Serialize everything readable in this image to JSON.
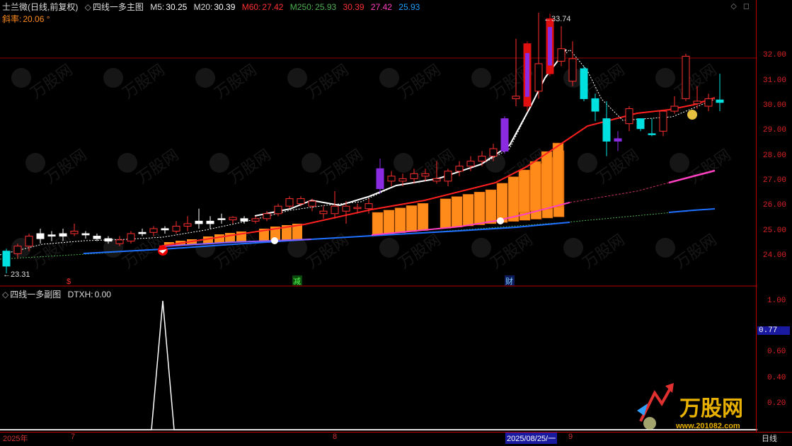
{
  "header": {
    "stock_name": "士兰微(日线,前复权)",
    "main_title": "四线一多主图",
    "m5_label": "M5:",
    "m5_value": "30.25",
    "m20_label": "M20:",
    "m20_value": "30.39",
    "m60_label": "M60:",
    "m60_value": "27.42",
    "m250_label": "M250:",
    "m250_value": "25.93",
    "extra1": "30.39",
    "extra2": "27.42",
    "extra3": "25.93",
    "slope_label": "斜率:",
    "slope_value": "20.06 °"
  },
  "sub_header": {
    "title": "四线一多副图",
    "dtxh_label": "DTXH:",
    "dtxh_value": "0.00"
  },
  "main_axis_ticks": [
    "32.00",
    "31.00",
    "30.00",
    "29.00",
    "28.00",
    "27.00",
    "26.00",
    "25.00",
    "24.00"
  ],
  "sub_axis_ticks": [
    "1.00",
    "0.77",
    "0.60",
    "0.40",
    "0.20"
  ],
  "annotations": {
    "high_price": "33.74",
    "low_price": "23.31",
    "marker_dollar": "$",
    "marker_jian": "减",
    "marker_cai": "财"
  },
  "date_axis": {
    "year": "2025年",
    "m7": "7",
    "m8": "8",
    "cursor_date": "2025/08/25/一",
    "m9": "9",
    "period": "日线"
  },
  "colors": {
    "up": "#ff3030",
    "down": "#00e0e0",
    "purple": "#8a2be2",
    "orange": "#ff8c1a",
    "white": "#ffffff",
    "ma_blue": "#1e6fff",
    "ma_pink": "#ff40c0",
    "red_line": "#ff2020"
  },
  "watermark": {
    "brand": "万股网",
    "site": "www.201082.com"
  }
}
